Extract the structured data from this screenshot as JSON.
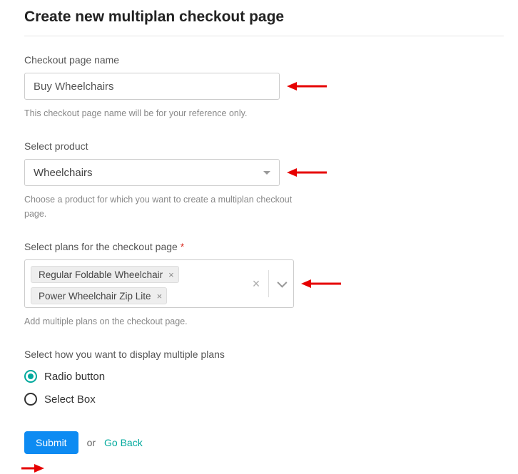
{
  "page": {
    "title": "Create new multiplan checkout page"
  },
  "form": {
    "name": {
      "label": "Checkout page name",
      "value": "Buy Wheelchairs",
      "helper": "This checkout page name will be for your reference only."
    },
    "product": {
      "label": "Select product",
      "value": "Wheelchairs",
      "helper": "Choose a product for which you want to create a multiplan checkout page."
    },
    "plans": {
      "label": "Select plans for the checkout page",
      "required_mark": "*",
      "selected": [
        "Regular Foldable Wheelchair",
        "Power Wheelchair Zip Lite"
      ],
      "helper": "Add multiple plans on the checkout page."
    },
    "display_mode": {
      "label": "Select how you want to display multiple plans",
      "options": {
        "radio": "Radio button",
        "select": "Select Box"
      },
      "selected": "radio"
    }
  },
  "actions": {
    "submit": "Submit",
    "or": "or",
    "goback": "Go Back"
  }
}
